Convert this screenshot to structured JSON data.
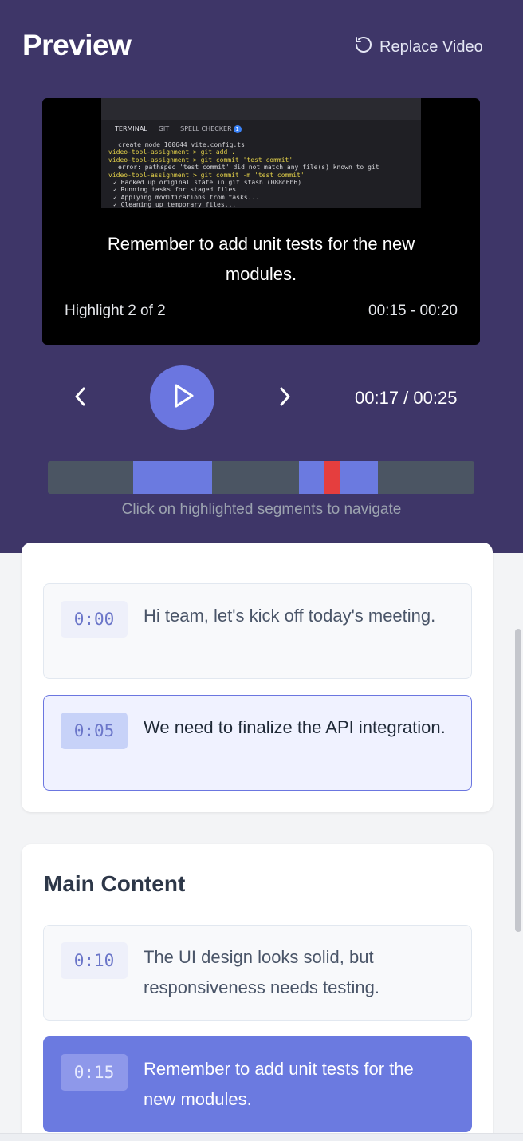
{
  "preview": {
    "title": "Preview",
    "replace_label": "Replace Video"
  },
  "video": {
    "terminal": {
      "tabs": [
        "TERMINAL",
        "GIT",
        "SPELL CHECKER"
      ],
      "badge": "1",
      "lines": [
        "create mode 100644 vite.config.ts",
        "video-tool-assignment > git add .",
        "video-tool-assignment > git commit 'test commit'",
        "error: pathspec 'test commit' did not match any file(s) known to git",
        "video-tool-assignment > git commit -m 'test commit'",
        "✓ Backed up original state in git stash (088d6b6)",
        "✓ Running tasks for staged files...",
        "✓ Applying modifications from tasks...",
        "✓ Cleaning up temporary files..."
      ]
    },
    "caption": "Remember to add unit tests for the new modules.",
    "highlight_info": "Highlight 2 of 2",
    "highlight_time": "00:15 - 00:20"
  },
  "controls": {
    "time_readout": "00:17 / 00:25"
  },
  "timeline": {
    "hint": "Click on highlighted segments to navigate",
    "duration_seconds": 25,
    "current_seconds": 17,
    "segments": [
      {
        "start": 5,
        "end": 10
      },
      {
        "start": 15,
        "end": 20
      }
    ]
  },
  "sections": [
    {
      "title": "",
      "items": [
        {
          "time": "0:00",
          "text": "Hi team, let's kick off today's meeting.",
          "state": "normal"
        },
        {
          "time": "0:05",
          "text": "We need to finalize the API integration.",
          "state": "selected"
        }
      ]
    },
    {
      "title": "Main Content",
      "items": [
        {
          "time": "0:10",
          "text": "The UI design looks solid, but responsiveness needs testing.",
          "state": "normal"
        },
        {
          "time": "0:15",
          "text": "Remember to add unit tests for the new modules.",
          "state": "current"
        }
      ]
    }
  ],
  "colors": {
    "header_bg": "#3e3668",
    "accent": "#6b7ae0",
    "playhead": "#e53e3e"
  }
}
